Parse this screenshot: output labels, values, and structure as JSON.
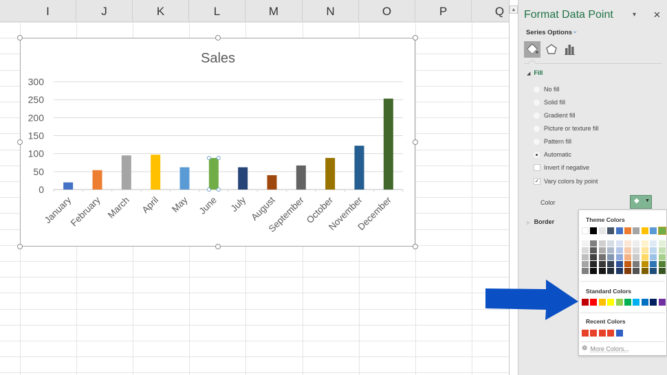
{
  "spreadsheet": {
    "columns": [
      "I",
      "J",
      "K",
      "L",
      "M",
      "N",
      "O",
      "P",
      "Q"
    ]
  },
  "chart_data": {
    "type": "bar",
    "title": "Sales",
    "categories": [
      "January",
      "February",
      "March",
      "April",
      "May",
      "June",
      "July",
      "August",
      "September",
      "October",
      "November",
      "December"
    ],
    "values": [
      20,
      54,
      95,
      97,
      62,
      88,
      62,
      40,
      67,
      88,
      122,
      253
    ],
    "bar_colors": [
      "#4472c4",
      "#ed7d31",
      "#a5a5a5",
      "#ffc000",
      "#5b9bd5",
      "#70ad47",
      "#264478",
      "#9e480e",
      "#636363",
      "#997300",
      "#255e91",
      "#43682b"
    ],
    "selected_point": "June",
    "yticks": [
      "0",
      "50",
      "100",
      "150",
      "200",
      "250",
      "300"
    ],
    "ylim": [
      0,
      300
    ],
    "xlabel": "",
    "ylabel": "",
    "grid": true,
    "legend": "none"
  },
  "panel": {
    "title": "Format Data Point",
    "minimize_icon": "▾",
    "close_icon": "✕",
    "series_options_label": "Series Options",
    "tabs": [
      {
        "name": "fill-line",
        "icon": "paint-bucket-icon",
        "active": true
      },
      {
        "name": "effects",
        "icon": "pentagon-icon",
        "active": false
      },
      {
        "name": "series-options",
        "icon": "bar-chart-icon",
        "active": false
      }
    ],
    "fill_section": "Fill",
    "fill_options": [
      {
        "label": "No fill",
        "type": "radio",
        "checked": false
      },
      {
        "label": "Solid fill",
        "type": "radio",
        "checked": false
      },
      {
        "label": "Gradient fill",
        "type": "radio",
        "checked": false
      },
      {
        "label": "Picture or texture fill",
        "type": "radio",
        "checked": false
      },
      {
        "label": "Pattern fill",
        "type": "radio",
        "checked": false
      },
      {
        "label": "Automatic",
        "type": "radio",
        "checked": true
      },
      {
        "label": "Invert if negative",
        "type": "checkbox",
        "checked": false
      },
      {
        "label": "Vary colors by point",
        "type": "checkbox",
        "checked": true
      }
    ],
    "color_label": "Color",
    "color_button_icon": "paint-bucket-icon",
    "border_section": "Border"
  },
  "palette": {
    "theme_heading": "Theme Colors",
    "theme_colors": [
      "#ffffff",
      "#000000",
      "#e7e6e6",
      "#44546a",
      "#4472c4",
      "#ed7d31",
      "#a5a5a5",
      "#ffc000",
      "#5b9bd5",
      "#70ad47"
    ],
    "theme_shades": [
      [
        "#f2f2f2",
        "#d9d9d9",
        "#bfbfbf",
        "#a6a6a6",
        "#808080"
      ],
      [
        "#808080",
        "#595959",
        "#404040",
        "#262626",
        "#0d0d0d"
      ],
      [
        "#d0cece",
        "#aeabab",
        "#757171",
        "#3a3838",
        "#171616"
      ],
      [
        "#d6dce4",
        "#adb9ca",
        "#8497b0",
        "#333f4f",
        "#222a35"
      ],
      [
        "#d9e2f3",
        "#b4c6e7",
        "#8eaadb",
        "#2f5496",
        "#1f3864"
      ],
      [
        "#fbe5d5",
        "#f7caac",
        "#f4b183",
        "#c55a11",
        "#833c0b"
      ],
      [
        "#ededed",
        "#dbdbdb",
        "#c9c9c9",
        "#7b7b7b",
        "#525252"
      ],
      [
        "#fff2cc",
        "#fee599",
        "#ffd965",
        "#bf9000",
        "#7f6000"
      ],
      [
        "#deebf6",
        "#bdd7ee",
        "#9cc3e5",
        "#2e75b5",
        "#1e4e79"
      ],
      [
        "#e2efd9",
        "#c5e0b3",
        "#a8d08d",
        "#538135",
        "#375623"
      ]
    ],
    "standard_heading": "Standard Colors",
    "standard_colors": [
      "#c00000",
      "#ff0000",
      "#ffc000",
      "#ffff00",
      "#92d050",
      "#00b050",
      "#00b0f0",
      "#0070c0",
      "#002060",
      "#7030a0"
    ],
    "recent_heading": "Recent Colors",
    "recent_colors": [
      "#e8412a",
      "#e8412a",
      "#e8412a",
      "#e8412a",
      "#2f5ec4"
    ],
    "more_colors_label": "More Colors..."
  },
  "annotation": {
    "arrow_color": "#0a4fc4",
    "points_to": "Standard Colors"
  }
}
